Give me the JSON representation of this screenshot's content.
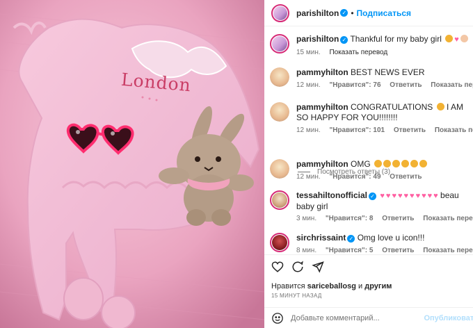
{
  "photo": {
    "embroidery_text": "London"
  },
  "header": {
    "username": "parishilton",
    "separator": "•",
    "follow_label": "Подписаться"
  },
  "comments": [
    {
      "username": "parishilton",
      "text": "Thankful for my baby girl",
      "emojis": [
        "crying-face",
        "pink-heart",
        "baby-face"
      ],
      "time": "15 мин.",
      "translate": "Показать перевод",
      "verified": true
    },
    {
      "username": "pammyhilton",
      "text": "BEST NEWS EVER",
      "time": "12 мин.",
      "likes": "\"Нравится\": 76",
      "reply": "Ответить",
      "translate": "Показать перевод"
    },
    {
      "username": "pammyhilton",
      "text_before": "CONGRATULATIONS",
      "text_after": "I AM SO HAPPY FOR YOU!!!!!!!!",
      "time": "12 мин.",
      "likes": "\"Нравится\": 101",
      "reply": "Ответить",
      "translate": "Показать перевод"
    },
    {
      "username": "pammyhilton",
      "text": "OMG",
      "emoji_count": 6,
      "time": "12 мин.",
      "likes": "\"Нравится\": 49",
      "reply": "Ответить"
    },
    {
      "username": "tessahiltonofficial",
      "verified": true,
      "heart_count": 10,
      "text_after": "beautiful baby girl",
      "text_line1_tail": "beau",
      "text_line2": "baby girl",
      "time": "3 мин.",
      "likes": "\"Нравится\": 8",
      "reply": "Ответить",
      "translate": "Показать перевод"
    },
    {
      "username": "sirchrissaint",
      "verified": true,
      "text": "Omg love u icon!!!",
      "time": "8 мин.",
      "likes": "\"Нравится\": 5",
      "reply": "Ответить",
      "translate": "Показать перевод"
    }
  ],
  "view_replies": "Посмотреть ответы (3)",
  "actions": {
    "likes_prefix": "Нравится",
    "likes_user": "sariceballosg",
    "likes_middle": "и",
    "likes_suffix": "другим",
    "time_ago": "15 МИНУТ НАЗАД",
    "comment_placeholder": "Добавьте комментарий...",
    "publish_label": "Опубликовать",
    "icons": [
      "heart-icon",
      "comment-icon",
      "share-icon"
    ]
  },
  "colors": {
    "accent": "#0095f6",
    "photo_bg": "#eaa7c2"
  }
}
